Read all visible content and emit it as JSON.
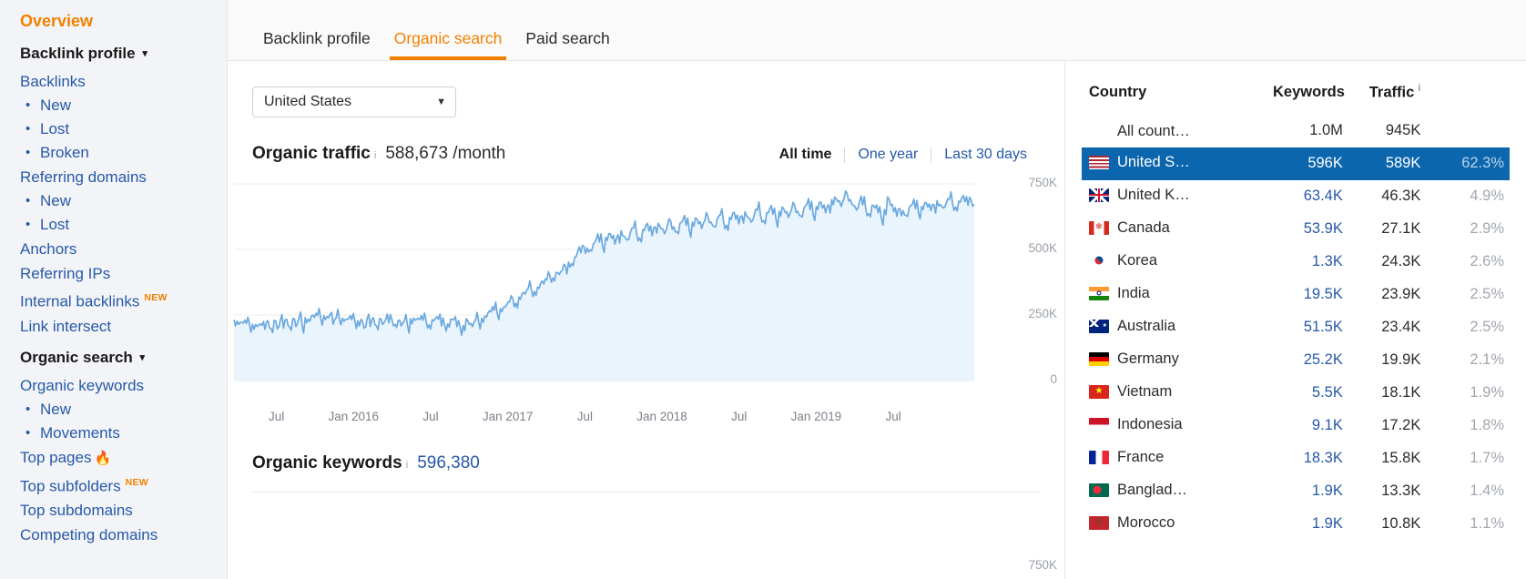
{
  "sidebar": {
    "overview": "Overview",
    "groups": [
      {
        "label": "Backlink profile",
        "caret": "▾",
        "items": [
          {
            "label": "Backlinks",
            "type": "link"
          },
          {
            "label": "New",
            "type": "sub"
          },
          {
            "label": "Lost",
            "type": "sub"
          },
          {
            "label": "Broken",
            "type": "sub"
          },
          {
            "label": "Referring domains",
            "type": "link"
          },
          {
            "label": "New",
            "type": "sub"
          },
          {
            "label": "Lost",
            "type": "sub"
          },
          {
            "label": "Anchors",
            "type": "link"
          },
          {
            "label": "Referring IPs",
            "type": "link"
          },
          {
            "label": "Internal backlinks",
            "type": "link",
            "badge": "NEW"
          },
          {
            "label": "Link intersect",
            "type": "link"
          }
        ]
      },
      {
        "label": "Organic search",
        "caret": "▾",
        "items": [
          {
            "label": "Organic keywords",
            "type": "link"
          },
          {
            "label": "New",
            "type": "sub"
          },
          {
            "label": "Movements",
            "type": "sub"
          },
          {
            "label": "Top pages",
            "type": "link",
            "flame": "🔥"
          },
          {
            "label": "Top subfolders",
            "type": "link",
            "badge": "NEW"
          },
          {
            "label": "Top subdomains",
            "type": "link"
          },
          {
            "label": "Competing domains",
            "type": "link"
          }
        ]
      }
    ]
  },
  "tabs": [
    {
      "label": "Backlink profile",
      "active": false
    },
    {
      "label": "Organic search",
      "active": true
    },
    {
      "label": "Paid search",
      "active": false
    }
  ],
  "filters": {
    "country_selected": "United States",
    "caret": "▼"
  },
  "organic_traffic": {
    "title": "Organic traffic",
    "info": "i",
    "value": "588,673 /month",
    "ranges": [
      {
        "label": "All time",
        "active": true
      },
      {
        "label": "One year",
        "active": false
      },
      {
        "label": "Last 30 days",
        "active": false
      }
    ]
  },
  "organic_keywords": {
    "title": "Organic keywords",
    "info": "i",
    "value": "596,380",
    "axis_top_label": "750K"
  },
  "colors": {
    "accent": "#f28000",
    "link": "#2659a8",
    "selected_row": "#0b66ae",
    "series_line": "#6aa9e0",
    "series_fill": "#eaf4fc"
  },
  "chart_data": {
    "type": "area",
    "title": "Organic traffic",
    "xlabel": "",
    "ylabel": "",
    "ylim": [
      0,
      750000
    ],
    "yticks": [
      0,
      250000,
      500000,
      750000
    ],
    "ytick_labels": [
      "0",
      "250K",
      "500K",
      "750K"
    ],
    "grid": true,
    "legend": "none",
    "xtick_labels": [
      "Jul",
      "Jan 2016",
      "Jul",
      "Jan 2017",
      "Jul",
      "Jan 2018",
      "Jul",
      "Jan 2019",
      "Jul"
    ],
    "series": [
      {
        "name": "Organic traffic",
        "values": [
          232000,
          226000,
          222000,
          219000,
          218000,
          216000,
          215000,
          214000,
          212000,
          210000,
          196000,
          228000,
          198000,
          230000,
          197000,
          232000,
          200000,
          234000,
          203000,
          236000,
          206000,
          238000,
          212000,
          240000,
          234000,
          246000,
          241000,
          248000,
          238000,
          248000,
          244000,
          252000,
          214000,
          240000,
          236000,
          238000,
          233000,
          236000,
          232000,
          230000,
          228000,
          234000,
          200000,
          238000,
          206000,
          240000,
          209000,
          237000,
          214000,
          234000,
          220000,
          232000,
          214000,
          230000,
          208000,
          228000,
          212000,
          236000,
          238000,
          234000,
          232000,
          230000,
          228000,
          212000,
          232000,
          236000,
          234000,
          208000,
          212000,
          216000,
          234000,
          232000,
          206000,
          204000,
          210000,
          236000,
          214000,
          206000,
          232000,
          224000,
          238000,
          246000,
          258000,
          262000,
          268000,
          256000,
          274000,
          280000,
          288000,
          300000,
          312000,
          296000,
          318000,
          332000,
          330000,
          352000,
          348000,
          340000,
          356000,
          372000,
          368000,
          384000,
          398000,
          392000,
          412000,
          404000,
          420000,
          438000,
          452000,
          446000,
          470000,
          494000,
          488000,
          512000,
          506000,
          498000,
          520000,
          540000,
          528000,
          512000,
          546000,
          560000,
          542000,
          520000,
          556000,
          572000,
          550000,
          536000,
          566000,
          582000,
          560000,
          544000,
          576000,
          592000,
          570000,
          552000,
          586000,
          600000,
          578000,
          560000,
          594000,
          608000,
          586000,
          568000,
          600000,
          614000,
          592000,
          574000,
          604000,
          620000,
          598000,
          580000,
          610000,
          626000,
          604000,
          586000,
          616000,
          632000,
          610000,
          592000,
          622000,
          638000,
          616000,
          598000,
          628000,
          644000,
          622000,
          604000,
          634000,
          650000,
          628000,
          610000,
          640000,
          656000,
          634000,
          616000,
          646000,
          662000,
          640000,
          622000,
          652000,
          668000,
          646000,
          628000,
          658000,
          674000,
          652000,
          634000,
          664000,
          680000,
          658000,
          640000,
          670000,
          690000,
          700000,
          682000,
          664000,
          696000,
          712000,
          690000,
          668000,
          650000,
          684000,
          670000,
          652000,
          636000,
          668000,
          658000,
          640000,
          624000,
          652000,
          700000,
          668000,
          644000,
          626000,
          656000,
          648000,
          630000,
          660000,
          672000,
          656000,
          640000,
          664000,
          678000,
          662000,
          648000,
          670000,
          686000,
          672000,
          658000,
          678000,
          692000,
          676000,
          662000,
          684000,
          698000,
          682000,
          668000,
          688000,
          672000
        ]
      }
    ]
  },
  "country_table": {
    "headers": {
      "country": "Country",
      "keywords": "Keywords",
      "traffic": "Traffic",
      "traffic_info": "i"
    },
    "rows": [
      {
        "name": "All count…",
        "keywords": "1.0M",
        "traffic": "945K",
        "pct": "",
        "flag": null,
        "selected": false,
        "all": true
      },
      {
        "name": "United S…",
        "keywords": "596K",
        "traffic": "589K",
        "pct": "62.3%",
        "flag": "us",
        "selected": true
      },
      {
        "name": "United K…",
        "keywords": "63.4K",
        "traffic": "46.3K",
        "pct": "4.9%",
        "flag": "gb",
        "selected": false
      },
      {
        "name": "Canada",
        "keywords": "53.9K",
        "traffic": "27.1K",
        "pct": "2.9%",
        "flag": "ca",
        "selected": false
      },
      {
        "name": "Korea",
        "keywords": "1.3K",
        "traffic": "24.3K",
        "pct": "2.6%",
        "flag": "kr",
        "selected": false
      },
      {
        "name": "India",
        "keywords": "19.5K",
        "traffic": "23.9K",
        "pct": "2.5%",
        "flag": "in",
        "selected": false
      },
      {
        "name": "Australia",
        "keywords": "51.5K",
        "traffic": "23.4K",
        "pct": "2.5%",
        "flag": "au",
        "selected": false
      },
      {
        "name": "Germany",
        "keywords": "25.2K",
        "traffic": "19.9K",
        "pct": "2.1%",
        "flag": "de",
        "selected": false
      },
      {
        "name": "Vietnam",
        "keywords": "5.5K",
        "traffic": "18.1K",
        "pct": "1.9%",
        "flag": "vn",
        "selected": false
      },
      {
        "name": "Indonesia",
        "keywords": "9.1K",
        "traffic": "17.2K",
        "pct": "1.8%",
        "flag": "id",
        "selected": false
      },
      {
        "name": "France",
        "keywords": "18.3K",
        "traffic": "15.8K",
        "pct": "1.7%",
        "flag": "fr",
        "selected": false
      },
      {
        "name": "Banglad…",
        "keywords": "1.9K",
        "traffic": "13.3K",
        "pct": "1.4%",
        "flag": "bd",
        "selected": false
      },
      {
        "name": "Morocco",
        "keywords": "1.9K",
        "traffic": "10.8K",
        "pct": "1.1%",
        "flag": "ma",
        "selected": false
      }
    ]
  }
}
